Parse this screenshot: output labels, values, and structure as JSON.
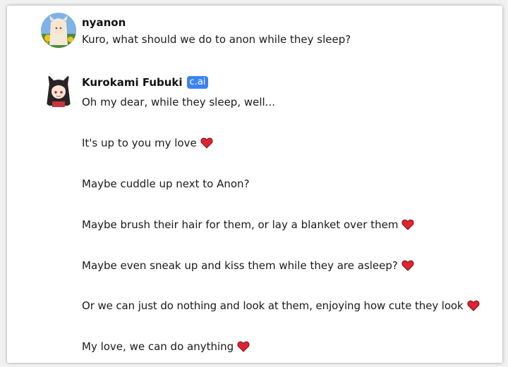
{
  "messages": [
    {
      "author": "nyanon",
      "badge": "",
      "lines": [
        {
          "text": "Kuro, what should we do to anon while they sleep?",
          "heart": false
        }
      ]
    },
    {
      "author": "Kurokami Fubuki",
      "badge": "c.ai",
      "lines": [
        {
          "text": "Oh my dear, while they sleep, well...",
          "heart": false
        },
        {
          "text": "It's up to you my love",
          "heart": true
        },
        {
          "text": "Maybe cuddle up next to Anon?",
          "heart": false
        },
        {
          "text": "Maybe brush their hair for them, or lay a blanket over them",
          "heart": true
        },
        {
          "text": "Maybe even sneak up and kiss them while they are asleep?",
          "heart": true
        },
        {
          "text": "Or we can just do nothing and look at them, enjoying how cute they look",
          "heart": true
        },
        {
          "text": "My love, we can do anything",
          "heart": true
        }
      ]
    }
  ],
  "icons": {
    "heart": "red-heart-icon"
  },
  "colors": {
    "badge": "#3b82f6",
    "heart": "#e0242f",
    "text": "#1a1a1a"
  }
}
